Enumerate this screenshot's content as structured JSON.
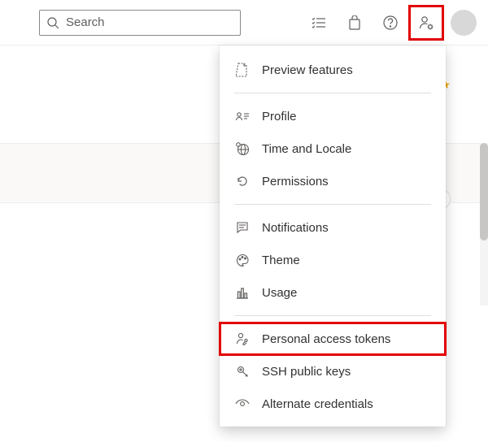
{
  "search": {
    "placeholder": "Search"
  },
  "menu": {
    "preview": "Preview features",
    "profile": "Profile",
    "time": "Time and Locale",
    "permissions": "Permissions",
    "notifications": "Notifications",
    "theme": "Theme",
    "usage": "Usage",
    "pat": "Personal access tokens",
    "ssh": "SSH public keys",
    "altcred": "Alternate credentials"
  }
}
